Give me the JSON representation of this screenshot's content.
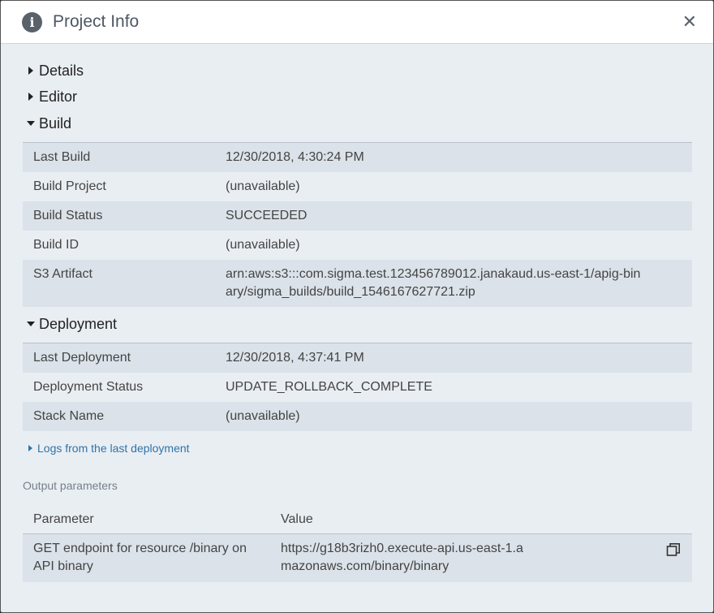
{
  "dialog": {
    "title": "Project Info",
    "info_icon": "i",
    "close_label": "✕"
  },
  "sections": {
    "details": "Details",
    "editor": "Editor",
    "build": "Build",
    "deployment": "Deployment"
  },
  "build_rows": [
    {
      "key": "Last Build",
      "value": "12/30/2018, 4:30:24 PM"
    },
    {
      "key": "Build Project",
      "value": "(unavailable)"
    },
    {
      "key": "Build Status",
      "value": "SUCCEEDED"
    },
    {
      "key": "Build ID",
      "value": "(unavailable)"
    },
    {
      "key": "S3 Artifact",
      "value": "arn:aws:s3:::com.sigma.test.123456789012.janakaud.us-east-1/apig-binary/sigma_builds/build_1546167627721.zip"
    }
  ],
  "deployment_rows": [
    {
      "key": "Last Deployment",
      "value": "12/30/2018, 4:37:41 PM"
    },
    {
      "key": "Deployment Status",
      "value": "UPDATE_ROLLBACK_COMPLETE"
    },
    {
      "key": "Stack Name",
      "value": "(unavailable)"
    }
  ],
  "logs_link": "Logs from the last deployment",
  "output": {
    "label": "Output parameters",
    "header_param": "Parameter",
    "header_value": "Value",
    "rows": [
      {
        "param": "GET endpoint for resource /binary on API binary",
        "value": "https://g18b3rizh0.execute-api.us-east-1.amazonaws.com/binary/binary"
      }
    ]
  },
  "icons": {
    "info": "info-icon",
    "close": "close-icon",
    "copy": "copy-icon",
    "expand": "caret-right-icon",
    "collapse": "caret-down-icon"
  }
}
